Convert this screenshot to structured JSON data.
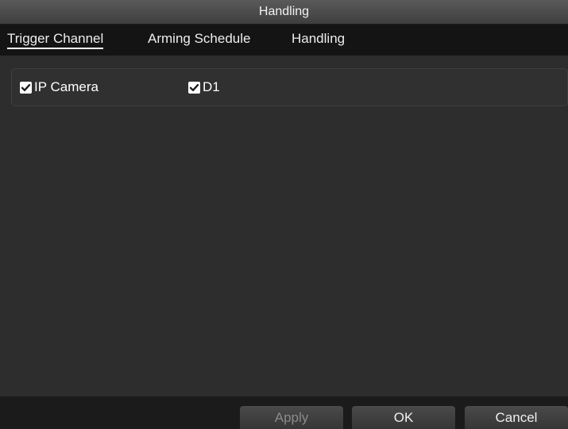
{
  "window": {
    "title": "Handling"
  },
  "tabs": [
    {
      "label": "Trigger Channel",
      "active": true
    },
    {
      "label": "Arming Schedule",
      "active": false
    },
    {
      "label": "Handling",
      "active": false
    }
  ],
  "channels": [
    {
      "label": "IP Camera",
      "checked": true
    },
    {
      "label": "D1",
      "checked": true
    }
  ],
  "buttons": {
    "apply": "Apply",
    "ok": "OK",
    "cancel": "Cancel"
  },
  "colors": {
    "background": "#2b2b2b",
    "tabbar": "#141414",
    "footer": "#1b1b1b",
    "disabled_text": "#8a8a8a"
  }
}
